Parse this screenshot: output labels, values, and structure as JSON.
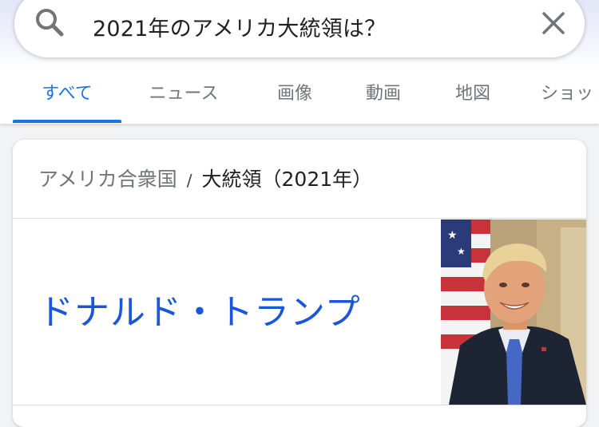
{
  "search": {
    "query": "2021年のアメリカ大統領は？",
    "icon": "search-icon",
    "clear_icon": "close-icon"
  },
  "tabs": [
    {
      "label": "すべて",
      "active": true
    },
    {
      "label": "ニュース",
      "active": false
    },
    {
      "label": "画像",
      "active": false
    },
    {
      "label": "動画",
      "active": false
    },
    {
      "label": "地図",
      "active": false
    },
    {
      "label": "ショッ",
      "active": false
    }
  ],
  "answer_card": {
    "breadcrumb_parent": "アメリカ合衆国",
    "breadcrumb_separator": "/",
    "breadcrumb_current": "大統領（2021年）",
    "answer": "ドナルド・トランプ",
    "image_icon": "portrait-photo"
  },
  "colors": {
    "accent": "#1a73e8",
    "answer_link": "#1a56db",
    "muted_text": "#70757a"
  }
}
